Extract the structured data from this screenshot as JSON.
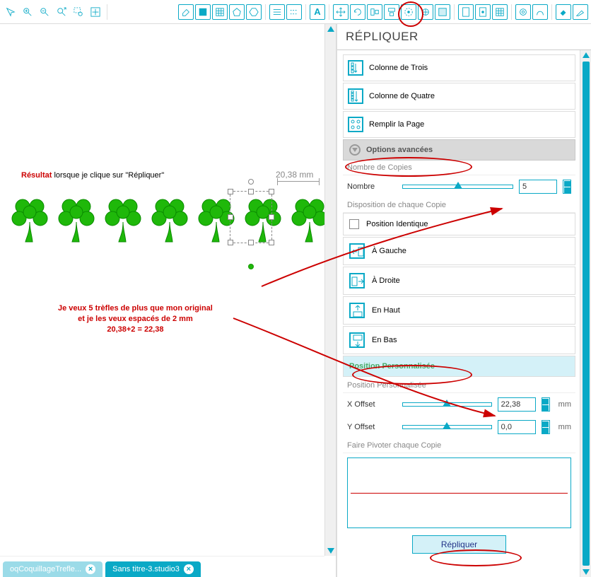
{
  "toolbar": {
    "groups": [
      [
        "pointer-icon",
        "zoom-in-icon",
        "zoom-out-icon",
        "zoom-drag-icon",
        "zoom-select-icon",
        "fit-icon"
      ],
      [
        "eraser-icon",
        "grid-icon",
        "grid-dense-icon",
        "pentagon-icon",
        "hexagon-icon"
      ],
      [
        "line-weight-icon",
        "line-style-icon"
      ],
      [
        "text-icon"
      ],
      [
        "move-icon",
        "rotate-icon",
        "align-icon",
        "align-v-icon",
        "replicate-icon",
        "group-icon",
        "layer-icon"
      ],
      [
        "page1-icon",
        "page2-icon",
        "grid2-icon"
      ],
      [
        "trace1-icon",
        "trace2-icon"
      ],
      [
        "fill-icon",
        "knife-icon"
      ]
    ]
  },
  "canvas": {
    "dimension_label": "20,38 mm",
    "result_bold": "Résultat",
    "result_rest": " lorsque je clique sur \"Répliquer\"",
    "annotation_line1": "Je veux 5 trèfles de plus que mon original",
    "annotation_line2": "et je les veux espacés de 2 mm",
    "annotation_line3": "20,38+2 = 22,38"
  },
  "tabs": [
    {
      "label": "oqCoquillageTrefle...",
      "active": false
    },
    {
      "label": "Sans titre-3.studio3",
      "active": true
    }
  ],
  "panel": {
    "title": "RÉPLIQUER",
    "quick_options": [
      {
        "label": "Colonne de Trois",
        "icon": "col3"
      },
      {
        "label": "Colonne de Quatre",
        "icon": "col4"
      },
      {
        "label": "Remplir la Page",
        "icon": "fill"
      }
    ],
    "advanced_header": "Options avancées",
    "copies_header": "Nombre de Copies",
    "copies_label": "Nombre",
    "copies_value": "5",
    "disposition_header": "Disposition de chaque Copie",
    "position_options": [
      {
        "label": "Position Identique",
        "type": "check"
      },
      {
        "label": "À Gauche",
        "type": "glyph"
      },
      {
        "label": "À Droite",
        "type": "glyph"
      },
      {
        "label": "En Haut",
        "type": "glyph"
      },
      {
        "label": "En Bas",
        "type": "glyph"
      },
      {
        "label": "Position Personnalisée",
        "type": "selected"
      }
    ],
    "custom_header": "Position Personnalisée",
    "xoffset_label": "X Offset",
    "xoffset_value": "22,38",
    "yoffset_label": "Y Offset",
    "yoffset_value": "0,0",
    "unit": "mm",
    "rotate_header": "Faire Pivoter chaque Copie",
    "action_label": "Répliquer"
  }
}
